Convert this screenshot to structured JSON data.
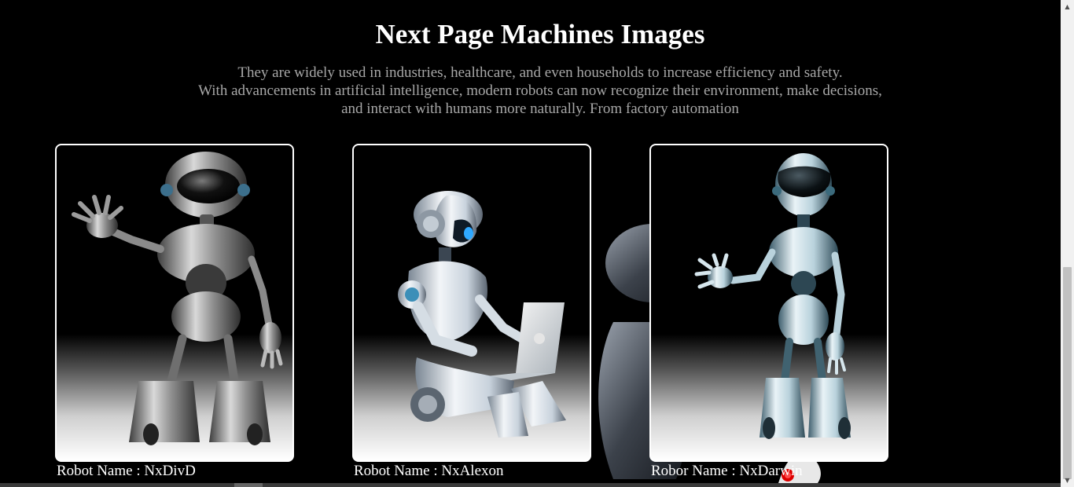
{
  "header": {
    "title": "Next Page Machines Images",
    "description_lines": [
      "They are widely used in industries, healthcare, and even households to increase efficiency and safety.",
      "With advancements in artificial intelligence, modern robots can now recognize their environment, make decisions,",
      "and interact with humans more naturally. From factory automation"
    ]
  },
  "cards": [
    {
      "caption": "Robot Name : NxDivD",
      "icon": "waving-robot-icon"
    },
    {
      "caption": "Robot Name : NxAlexon",
      "icon": "laptop-robot-icon"
    },
    {
      "caption": "Robor Name : NxDarwin",
      "icon": "standing-robot-icon"
    }
  ],
  "colors": {
    "background": "#000000",
    "title": "#ffffff",
    "description": "#a7a7a7",
    "card_border": "#ffffff"
  }
}
